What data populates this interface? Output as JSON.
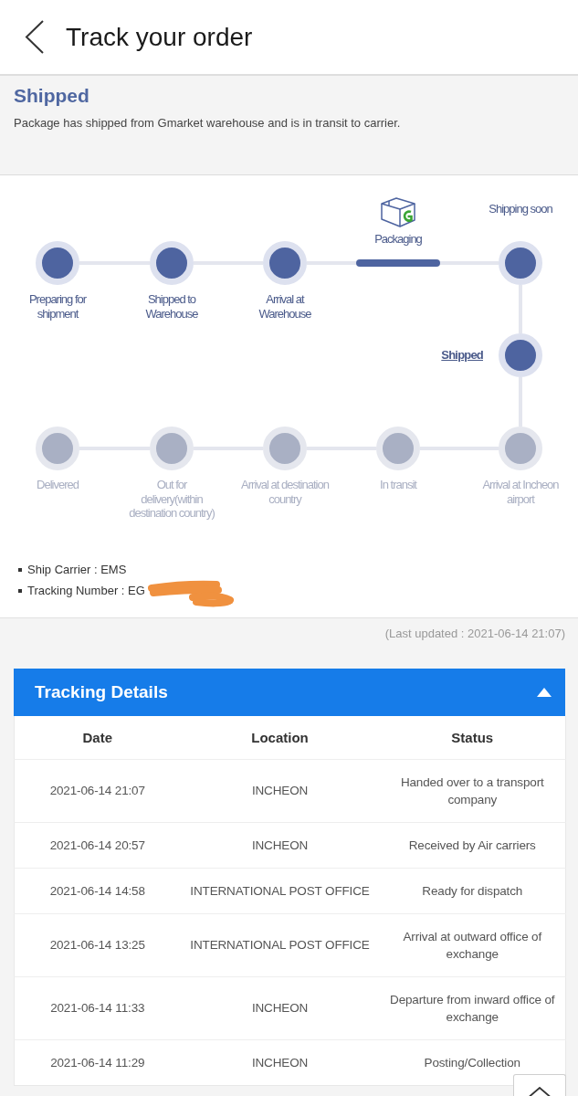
{
  "header": {
    "title": "Track your order"
  },
  "status": {
    "title": "Shipped",
    "description": "Package has shipped from Gmarket warehouse and is in transit to carrier."
  },
  "progress": {
    "steps": [
      {
        "label": "Preparing for shipment",
        "kind": "node",
        "done": true,
        "active": false
      },
      {
        "label": "Shipped to Warehouse",
        "kind": "node",
        "done": true,
        "active": false
      },
      {
        "label": "Arrival at Warehouse",
        "kind": "node",
        "done": true,
        "active": false
      },
      {
        "label": "Packaging",
        "kind": "bar",
        "done": true,
        "active": false
      },
      {
        "label": "Shipping soon",
        "kind": "node",
        "done": true,
        "active": false
      },
      {
        "label": "Shipped",
        "kind": "node",
        "done": true,
        "active": true
      },
      {
        "label": "Delivered",
        "kind": "node",
        "done": false,
        "active": false
      },
      {
        "label": "Out for delivery(within destination country)",
        "kind": "node",
        "done": false,
        "active": false
      },
      {
        "label": "Arrival at destination country",
        "kind": "node",
        "done": false,
        "active": false
      },
      {
        "label": "In transit",
        "kind": "node",
        "done": false,
        "active": false
      },
      {
        "label": "Arrival at Incheon airport",
        "kind": "node",
        "done": false,
        "active": false
      }
    ]
  },
  "shipment_info": [
    {
      "text": "Ship Carrier : EMS"
    },
    {
      "text": "Tracking Number : EG",
      "redacted": true
    }
  ],
  "last_updated": "(Last updated : 2021-06-14 21:07)",
  "tracking_details": {
    "title": "Tracking Details",
    "expanded": true,
    "columns": [
      "Date",
      "Location",
      "Status"
    ],
    "rows": [
      {
        "date": "2021-06-14 21:07",
        "location": "INCHEON",
        "status": "Handed over to a transport company"
      },
      {
        "date": "2021-06-14 20:57",
        "location": "INCHEON",
        "status": "Received by Air carriers"
      },
      {
        "date": "2021-06-14 14:58",
        "location": "INTERNATIONAL POST OFFICE",
        "status": "Ready for dispatch"
      },
      {
        "date": "2021-06-14 13:25",
        "location": "INTERNATIONAL POST OFFICE",
        "status": "Arrival at outward office of exchange"
      },
      {
        "date": "2021-06-14 11:33",
        "location": "INCHEON",
        "status": "Departure from inward office of exchange"
      },
      {
        "date": "2021-06-14 11:29",
        "location": "INCHEON",
        "status": "Posting/Collection"
      }
    ]
  }
}
